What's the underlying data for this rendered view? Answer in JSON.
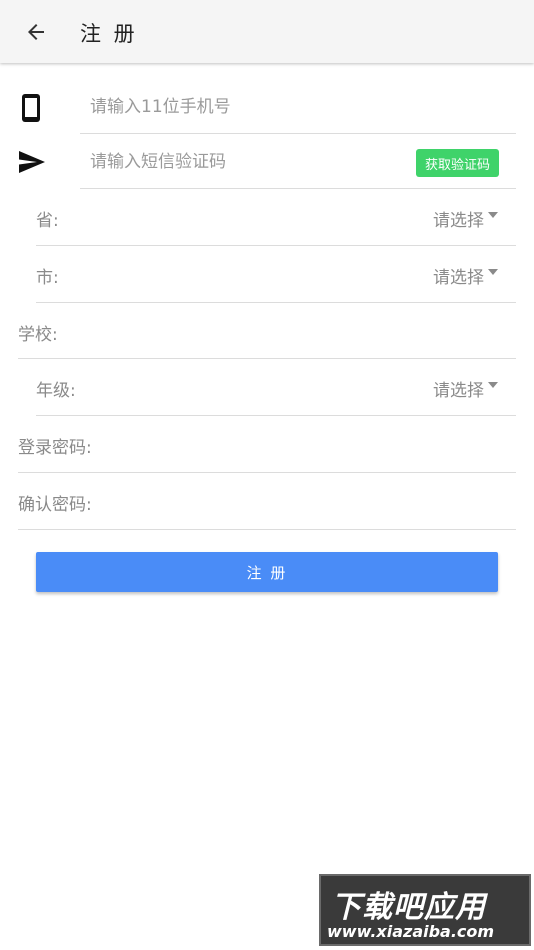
{
  "appbar": {
    "title": "注 册"
  },
  "form": {
    "phone": {
      "placeholder": "请输入11位手机号",
      "icon": "phone-icon"
    },
    "sms": {
      "placeholder": "请输入短信验证码",
      "icon": "send-icon",
      "button_label": "获取验证码",
      "button_color": "#3fd36a"
    },
    "province": {
      "label": "省:",
      "value": "请选择"
    },
    "city": {
      "label": "市:",
      "value": "请选择"
    },
    "school": {
      "label": "学校:"
    },
    "grade": {
      "label": "年级:",
      "value": "请选择"
    },
    "password": {
      "label": "登录密码:"
    },
    "confirm_password": {
      "label": "确认密码:"
    }
  },
  "submit": {
    "label": "注 册",
    "color": "#4a8cf7"
  },
  "watermark": {
    "title": "下载吧应用",
    "url": "www.xiazaiba.com"
  }
}
